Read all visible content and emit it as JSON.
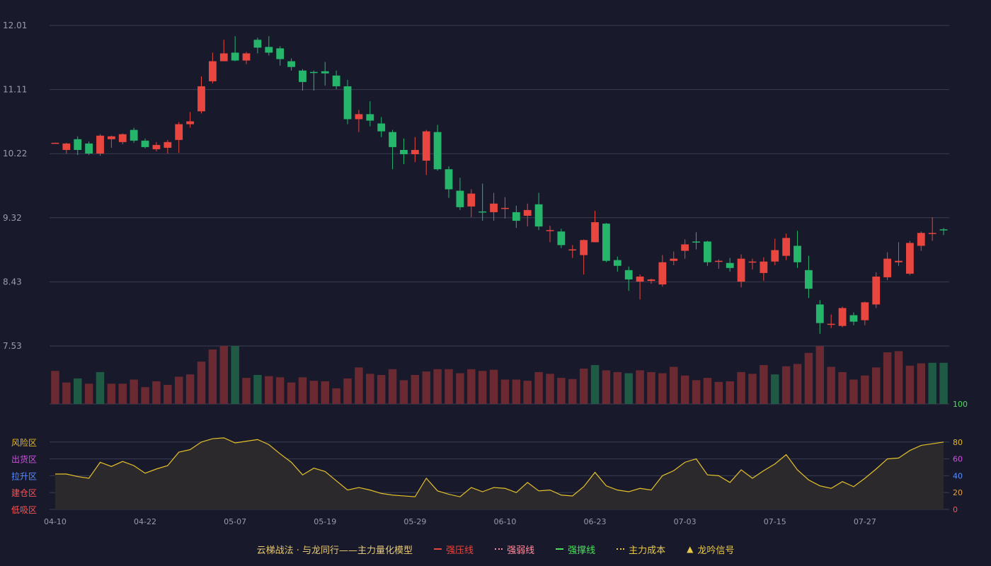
{
  "colors": {
    "background": "#181a2c",
    "grid": "#3a3d52",
    "axis_text": "#9a9cab",
    "up": "#e8463e",
    "down": "#26b66b",
    "volume_up": "#6b2a31",
    "volume_down": "#1f5a45",
    "score_line": "#e5c12a",
    "score_fill": "#2c2a2c"
  },
  "chart_data": [
    {
      "type": "candlestick",
      "title": "",
      "y_ticks": [
        "12.01",
        "11.11",
        "10.22",
        "9.32",
        "8.43",
        "7.53"
      ],
      "ylim": [
        7.53,
        12.01
      ],
      "x_ticks": [
        "04-10",
        "04-22",
        "05-07",
        "05-19",
        "05-29",
        "06-10",
        "06-23",
        "07-03",
        "07-15",
        "07-27"
      ],
      "x_tick_index": [
        0,
        8,
        16,
        24,
        32,
        40,
        48,
        56,
        64,
        72
      ],
      "ohlc": [
        [
          10.37,
          10.37,
          10.37,
          10.37
        ],
        [
          10.27,
          10.36,
          10.22,
          10.37
        ],
        [
          10.42,
          10.27,
          10.2,
          10.46
        ],
        [
          10.36,
          10.22,
          10.2,
          10.39
        ],
        [
          10.22,
          10.47,
          10.19,
          10.49
        ],
        [
          10.42,
          10.46,
          10.3,
          10.47
        ],
        [
          10.38,
          10.49,
          10.35,
          10.5
        ],
        [
          10.55,
          10.4,
          10.37,
          10.58
        ],
        [
          10.4,
          10.31,
          10.29,
          10.43
        ],
        [
          10.28,
          10.34,
          10.25,
          10.38
        ],
        [
          10.3,
          10.38,
          10.22,
          10.41
        ],
        [
          10.41,
          10.63,
          10.23,
          10.66
        ],
        [
          10.63,
          10.67,
          10.58,
          10.8
        ],
        [
          10.81,
          11.16,
          10.78,
          11.3
        ],
        [
          11.23,
          11.51,
          11.2,
          11.63
        ],
        [
          11.51,
          11.62,
          11.53,
          11.81
        ],
        [
          11.63,
          11.52,
          11.51,
          11.86
        ],
        [
          11.52,
          11.62,
          11.47,
          11.64
        ],
        [
          11.81,
          11.7,
          11.62,
          11.84
        ],
        [
          11.71,
          11.63,
          11.59,
          11.86
        ],
        [
          11.69,
          11.54,
          11.45,
          11.72
        ],
        [
          11.51,
          11.43,
          11.38,
          11.55
        ],
        [
          11.38,
          11.22,
          11.1,
          11.4
        ],
        [
          11.36,
          11.35,
          11.1,
          11.38
        ],
        [
          11.37,
          11.34,
          11.17,
          11.5
        ],
        [
          11.31,
          11.16,
          11.12,
          11.38
        ],
        [
          11.16,
          10.7,
          10.63,
          11.25
        ],
        [
          10.7,
          10.77,
          10.52,
          10.83
        ],
        [
          10.77,
          10.68,
          10.6,
          10.95
        ],
        [
          10.64,
          10.53,
          10.45,
          10.73
        ],
        [
          10.52,
          10.31,
          10.0,
          10.55
        ],
        [
          10.27,
          10.21,
          10.07,
          10.43
        ],
        [
          10.21,
          10.27,
          10.1,
          10.45
        ],
        [
          10.12,
          10.53,
          9.92,
          10.55
        ],
        [
          10.52,
          10.0,
          9.98,
          10.62
        ],
        [
          10.0,
          9.72,
          9.6,
          10.04
        ],
        [
          9.7,
          9.47,
          9.43,
          9.88
        ],
        [
          9.48,
          9.66,
          9.33,
          9.72
        ],
        [
          9.41,
          9.4,
          9.28,
          9.8
        ],
        [
          9.4,
          9.52,
          9.28,
          9.67
        ],
        [
          9.45,
          9.46,
          9.31,
          9.61
        ],
        [
          9.4,
          9.28,
          9.18,
          9.49
        ],
        [
          9.35,
          9.43,
          9.2,
          9.52
        ],
        [
          9.51,
          9.2,
          9.15,
          9.67
        ],
        [
          9.14,
          9.15,
          8.98,
          9.21
        ],
        [
          9.13,
          8.94,
          8.9,
          9.17
        ],
        [
          8.87,
          8.88,
          8.76,
          8.94
        ],
        [
          8.8,
          9.01,
          8.53,
          9.02
        ],
        [
          8.98,
          9.26,
          8.98,
          9.42
        ],
        [
          9.24,
          8.72,
          8.7,
          9.25
        ],
        [
          8.73,
          8.65,
          8.57,
          8.78
        ],
        [
          8.59,
          8.46,
          8.3,
          8.64
        ],
        [
          8.43,
          8.5,
          8.18,
          8.53
        ],
        [
          8.44,
          8.46,
          8.4,
          8.47
        ],
        [
          8.39,
          8.7,
          8.36,
          8.8
        ],
        [
          8.72,
          8.75,
          8.66,
          8.85
        ],
        [
          8.86,
          8.95,
          8.75,
          9.02
        ],
        [
          8.99,
          8.98,
          8.88,
          9.12
        ],
        [
          8.99,
          8.7,
          8.65,
          9.0
        ],
        [
          8.71,
          8.72,
          8.61,
          8.74
        ],
        [
          8.69,
          8.62,
          8.57,
          8.76
        ],
        [
          8.43,
          8.75,
          8.35,
          8.81
        ],
        [
          8.71,
          8.71,
          8.6,
          8.75
        ],
        [
          8.55,
          8.71,
          8.44,
          8.77
        ],
        [
          8.71,
          8.87,
          8.66,
          9.03
        ],
        [
          8.79,
          9.04,
          8.73,
          9.1
        ],
        [
          8.93,
          8.7,
          8.62,
          9.14
        ],
        [
          8.59,
          8.33,
          8.2,
          8.79
        ],
        [
          8.11,
          7.85,
          7.7,
          8.17
        ],
        [
          7.84,
          7.84,
          7.78,
          7.97
        ],
        [
          7.81,
          8.06,
          7.79,
          8.08
        ],
        [
          7.96,
          7.87,
          7.82,
          8.0
        ],
        [
          7.89,
          8.14,
          7.82,
          8.15
        ],
        [
          8.11,
          8.5,
          8.06,
          8.56
        ],
        [
          8.49,
          8.75,
          8.45,
          8.84
        ],
        [
          8.7,
          8.72,
          8.65,
          8.98
        ],
        [
          8.54,
          8.97,
          8.52,
          9.0
        ],
        [
          8.93,
          9.11,
          8.86,
          9.13
        ],
        [
          9.11,
          9.11,
          9.0,
          9.33
        ],
        [
          9.16,
          9.15,
          9.08,
          9.18
        ]
      ]
    },
    {
      "type": "bar",
      "title": "",
      "ylim": [
        0,
        1
      ],
      "values": [
        0.57,
        0.37,
        0.44,
        0.35,
        0.55,
        0.35,
        0.35,
        0.42,
        0.29,
        0.39,
        0.33,
        0.47,
        0.51,
        0.73,
        0.94,
        1.0,
        1.0,
        0.45,
        0.5,
        0.48,
        0.46,
        0.37,
        0.46,
        0.4,
        0.39,
        0.27,
        0.44,
        0.63,
        0.52,
        0.5,
        0.6,
        0.41,
        0.5,
        0.56,
        0.6,
        0.6,
        0.53,
        0.6,
        0.57,
        0.59,
        0.42,
        0.42,
        0.4,
        0.55,
        0.52,
        0.45,
        0.43,
        0.61,
        0.67,
        0.58,
        0.55,
        0.53,
        0.58,
        0.55,
        0.53,
        0.64,
        0.49,
        0.41,
        0.45,
        0.38,
        0.39,
        0.55,
        0.52,
        0.67,
        0.51,
        0.65,
        0.69,
        0.88,
        1.0,
        0.64,
        0.55,
        0.42,
        0.49,
        0.63,
        0.89,
        0.91,
        0.66,
        0.7,
        0.71,
        0.71
      ],
      "direction": [
        "u",
        "u",
        "d",
        "u",
        "d",
        "u",
        "u",
        "u",
        "u",
        "u",
        "u",
        "u",
        "u",
        "u",
        "u",
        "u",
        "d",
        "u",
        "d",
        "u",
        "u",
        "u",
        "u",
        "u",
        "u",
        "u",
        "u",
        "u",
        "u",
        "u",
        "u",
        "u",
        "u",
        "u",
        "u",
        "u",
        "u",
        "u",
        "u",
        "u",
        "u",
        "u",
        "u",
        "u",
        "u",
        "u",
        "u",
        "u",
        "d",
        "u",
        "u",
        "d",
        "u",
        "u",
        "u",
        "u",
        "u",
        "u",
        "u",
        "u",
        "u",
        "u",
        "u",
        "u",
        "d",
        "u",
        "u",
        "u",
        "u",
        "u",
        "u",
        "u",
        "u",
        "u",
        "u",
        "u",
        "u",
        "u",
        "d",
        "d"
      ]
    },
    {
      "type": "area",
      "title": "",
      "ylim": [
        0,
        100
      ],
      "y_ticks": [
        "100",
        "80",
        "60",
        "40",
        "20",
        "0"
      ],
      "zone_labels": [
        "风险区",
        "出货区",
        "拉升区",
        "建仓区",
        "低吸区"
      ],
      "values": [
        42,
        42,
        39,
        37,
        56,
        51,
        57,
        52,
        43,
        48,
        52,
        68,
        71,
        80,
        84,
        85,
        79,
        81,
        83,
        77,
        66,
        56,
        41,
        49,
        45,
        34,
        23,
        26,
        23,
        19,
        17,
        16,
        15,
        37,
        22,
        18,
        15,
        26,
        21,
        26,
        25,
        20,
        32,
        22,
        23,
        17,
        16,
        27,
        44,
        28,
        23,
        21,
        25,
        23,
        40,
        46,
        56,
        60,
        41,
        40,
        32,
        47,
        37,
        46,
        54,
        65,
        47,
        35,
        28,
        25,
        33,
        27,
        37,
        48,
        60,
        61,
        70,
        76,
        78,
        80
      ]
    }
  ],
  "legend": {
    "title": "云梯战法 · 与龙同行——主力量化模型",
    "items": [
      {
        "label": "强压线",
        "color": "#e8463e",
        "style": "solid"
      },
      {
        "label": "强弱线",
        "color": "#ff8fa0",
        "style": "dashed"
      },
      {
        "label": "强撑线",
        "color": "#4ae05a",
        "style": "solid"
      },
      {
        "label": "主力成本",
        "color": "#e8c84a",
        "style": "dashed"
      },
      {
        "label": "龙吟信号",
        "color": "#e8c84a",
        "style": "triangle"
      }
    ]
  }
}
